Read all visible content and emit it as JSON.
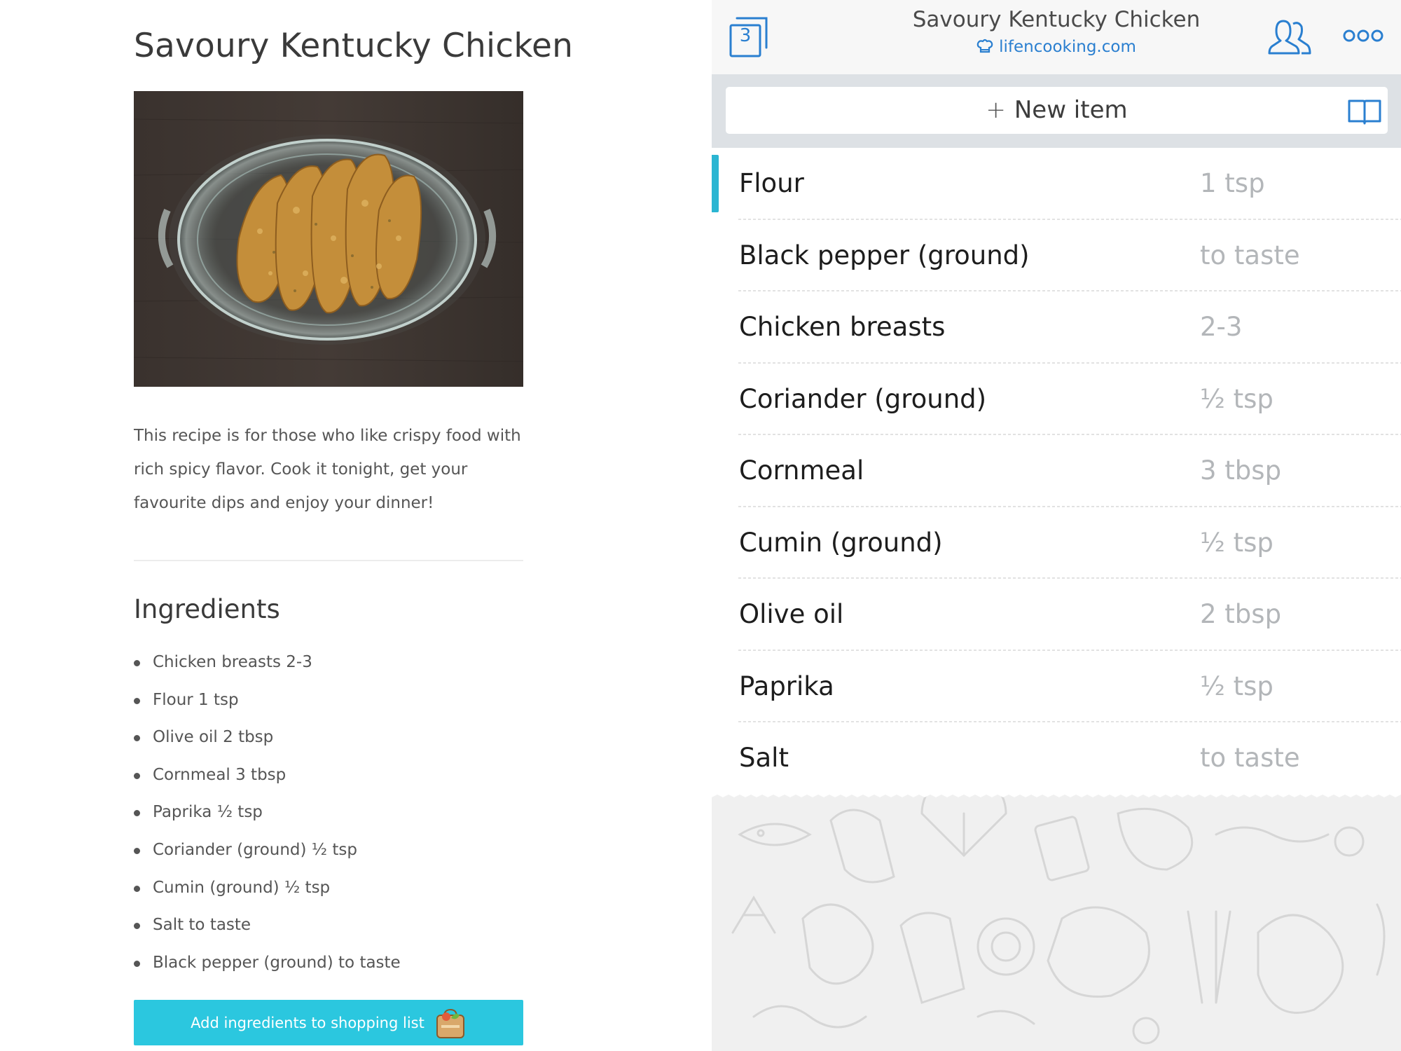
{
  "recipe_page": {
    "title": "Savoury Kentucky Chicken",
    "photo_alt": "",
    "description": "This recipe is for those who like crispy food with rich spicy flavor. Cook it tonight, get your favourite dips and enjoy your dinner!",
    "ingredients_heading": "Ingredients",
    "ingredients": [
      "Chicken breasts 2-3",
      "Flour 1 tsp",
      "Olive oil 2 tbsp",
      "Cornmeal 3 tbsp",
      "Paprika ½ tsp",
      "Coriander (ground) ½ tsp",
      "Cumin (ground) ½ tsp",
      "Salt to taste",
      "Black pepper (ground) to taste"
    ],
    "add_button_label": "Add ingredients to shopping list",
    "add_button_icon": "shopping-bag-icon",
    "button_color": "#2bc7df"
  },
  "shopping_app": {
    "header": {
      "counter": "3",
      "title": "Savoury Kentucky Chicken",
      "source": "lifencooking.com",
      "source_icon": "chef-hat-icon",
      "share_icon": "share-users-icon",
      "more_icon": "more-options-icon",
      "accent_color": "#2a7fd0"
    },
    "toolbar": {
      "new_item_plus": "+",
      "new_item_label": "New item",
      "book_icon": "book-icon"
    },
    "items": [
      {
        "name": "Flour",
        "qty": "1 tsp",
        "active": true
      },
      {
        "name": "Black pepper (ground)",
        "qty": "to taste"
      },
      {
        "name": "Chicken breasts",
        "qty": "2-3"
      },
      {
        "name": "Coriander (ground)",
        "qty": "½ tsp"
      },
      {
        "name": "Cornmeal",
        "qty": "3 tbsp"
      },
      {
        "name": "Cumin (ground)",
        "qty": "½ tsp"
      },
      {
        "name": "Olive oil",
        "qty": "2 tbsp"
      },
      {
        "name": "Paprika",
        "qty": "½ tsp"
      },
      {
        "name": "Salt",
        "qty": "to taste"
      }
    ],
    "active_item_color": "#2bb5d2"
  }
}
